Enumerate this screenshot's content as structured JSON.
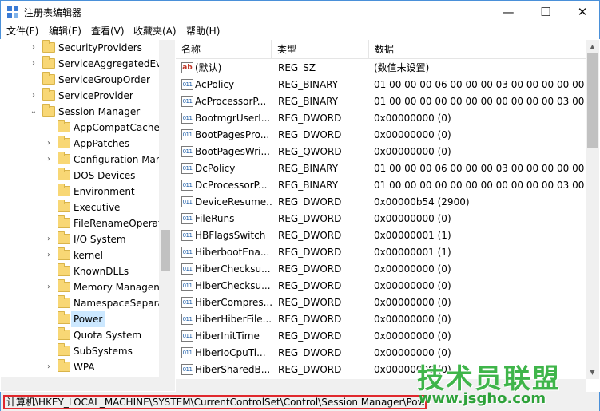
{
  "window": {
    "title": "注册表编辑器",
    "min_glyph": "—",
    "max_glyph": "☐",
    "close_glyph": "✕"
  },
  "menu": [
    "文件(F)",
    "编辑(E)",
    "查看(V)",
    "收藏夹(A)",
    "帮助(H)"
  ],
  "tree": {
    "items": [
      {
        "label": "SecurityProviders",
        "level": 1,
        "expandable": true,
        "expanded": false
      },
      {
        "label": "ServiceAggregatedEv",
        "level": 1,
        "expandable": true,
        "expanded": false
      },
      {
        "label": "ServiceGroupOrder",
        "level": 1,
        "expandable": false,
        "expanded": false
      },
      {
        "label": "ServiceProvider",
        "level": 1,
        "expandable": true,
        "expanded": false
      },
      {
        "label": "Session Manager",
        "level": 1,
        "expandable": true,
        "expanded": true
      },
      {
        "label": "AppCompatCache",
        "level": 2,
        "expandable": false,
        "expanded": false
      },
      {
        "label": "AppPatches",
        "level": 2,
        "expandable": true,
        "expanded": false
      },
      {
        "label": "Configuration Mar",
        "level": 2,
        "expandable": true,
        "expanded": false
      },
      {
        "label": "DOS Devices",
        "level": 2,
        "expandable": false,
        "expanded": false
      },
      {
        "label": "Environment",
        "level": 2,
        "expandable": false,
        "expanded": false
      },
      {
        "label": "Executive",
        "level": 2,
        "expandable": false,
        "expanded": false
      },
      {
        "label": "FileRenameOperat",
        "level": 2,
        "expandable": false,
        "expanded": false
      },
      {
        "label": "I/O System",
        "level": 2,
        "expandable": true,
        "expanded": false
      },
      {
        "label": "kernel",
        "level": 2,
        "expandable": true,
        "expanded": false
      },
      {
        "label": "KnownDLLs",
        "level": 2,
        "expandable": false,
        "expanded": false
      },
      {
        "label": "Memory Managen",
        "level": 2,
        "expandable": true,
        "expanded": false
      },
      {
        "label": "NamespaceSepara",
        "level": 2,
        "expandable": false,
        "expanded": false
      },
      {
        "label": "Power",
        "level": 2,
        "expandable": false,
        "expanded": false,
        "selected": true
      },
      {
        "label": "Quota System",
        "level": 2,
        "expandable": false,
        "expanded": false
      },
      {
        "label": "SubSystems",
        "level": 2,
        "expandable": false,
        "expanded": false
      },
      {
        "label": "WPA",
        "level": 2,
        "expandable": true,
        "expanded": false
      }
    ]
  },
  "list": {
    "columns": [
      "名称",
      "类型",
      "数据"
    ],
    "rows": [
      {
        "icon": "ab",
        "name": "(默认)",
        "type": "REG_SZ",
        "data": "(数值未设置)"
      },
      {
        "icon": "bin",
        "name": "AcPolicy",
        "type": "REG_BINARY",
        "data": "01 00 00 00 06 00 00 00 03 00 00 00 00 00 0"
      },
      {
        "icon": "bin",
        "name": "AcProcessorP...",
        "type": "REG_BINARY",
        "data": "01 00 00 00 00 00 00 00 00 00 00 00 03 00 0"
      },
      {
        "icon": "bin",
        "name": "BootmgrUserI...",
        "type": "REG_DWORD",
        "data": "0x00000000 (0)"
      },
      {
        "icon": "bin",
        "name": "BootPagesPro...",
        "type": "REG_DWORD",
        "data": "0x00000000 (0)"
      },
      {
        "icon": "bin",
        "name": "BootPagesWri...",
        "type": "REG_QWORD",
        "data": "0x00000000 (0)"
      },
      {
        "icon": "bin",
        "name": "DcPolicy",
        "type": "REG_BINARY",
        "data": "01 00 00 00 06 00 00 00 03 00 00 00 00 00 0"
      },
      {
        "icon": "bin",
        "name": "DcProcessorP...",
        "type": "REG_BINARY",
        "data": "01 00 00 00 00 00 00 00 00 00 00 00 03 00 0"
      },
      {
        "icon": "bin",
        "name": "DeviceResume...",
        "type": "REG_DWORD",
        "data": "0x00000b54 (2900)"
      },
      {
        "icon": "bin",
        "name": "FileRuns",
        "type": "REG_DWORD",
        "data": "0x00000000 (0)"
      },
      {
        "icon": "bin",
        "name": "HBFlagsSwitch",
        "type": "REG_DWORD",
        "data": "0x00000001 (1)"
      },
      {
        "icon": "bin",
        "name": "HiberbootEna...",
        "type": "REG_DWORD",
        "data": "0x00000001 (1)"
      },
      {
        "icon": "bin",
        "name": "HiberChecksu...",
        "type": "REG_DWORD",
        "data": "0x00000000 (0)"
      },
      {
        "icon": "bin",
        "name": "HiberChecksu...",
        "type": "REG_DWORD",
        "data": "0x00000000 (0)"
      },
      {
        "icon": "bin",
        "name": "HiberCompres...",
        "type": "REG_DWORD",
        "data": "0x00000000 (0)"
      },
      {
        "icon": "bin",
        "name": "HiberHiberFile...",
        "type": "REG_DWORD",
        "data": "0x00000000 (0)"
      },
      {
        "icon": "bin",
        "name": "HiberInitTime",
        "type": "REG_DWORD",
        "data": "0x00000000 (0)"
      },
      {
        "icon": "bin",
        "name": "HiberIoCpuTi...",
        "type": "REG_DWORD",
        "data": "0x00000000 (0)"
      },
      {
        "icon": "bin",
        "name": "HiberSharedB...",
        "type": "REG_DWORD",
        "data": "0x00000000 (0)"
      }
    ]
  },
  "status": {
    "path": "计算机\\HKEY_LOCAL_MACHINE\\SYSTEM\\CurrentControlSet\\Control\\Session Manager\\Power"
  },
  "watermark": {
    "title": "技术员联盟",
    "url": "www.jsgho.com"
  },
  "colors": {
    "accent": "#4a90d9",
    "selection": "#cce8ff",
    "status_highlight": "#e0282d",
    "watermark_green": "#3fb54a"
  }
}
